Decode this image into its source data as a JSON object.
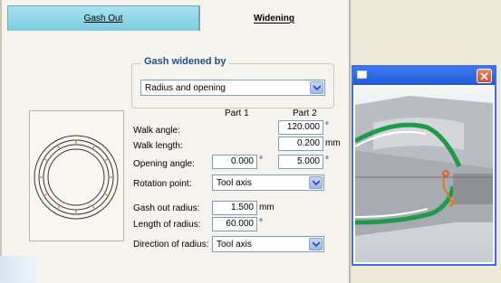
{
  "tabs": [
    {
      "label": "Gash Out",
      "active": false
    },
    {
      "label": "Widening",
      "active": true
    }
  ],
  "group": {
    "title": "Gash widened by",
    "method_value": "Radius and opening"
  },
  "columns": {
    "part1": "Part 1",
    "part2": "Part 2"
  },
  "params": {
    "walk_angle": {
      "label": "Walk angle:",
      "part2": "120.000",
      "unit": "°"
    },
    "walk_length": {
      "label": "Walk length:",
      "part2": "0.200",
      "unit": "mm"
    },
    "opening_angle": {
      "label": "Opening angle:",
      "part1": "0.000",
      "part1_unit": "°",
      "part2": "5.000",
      "part2_unit": "°"
    },
    "rotation_point": {
      "label": "Rotation point:",
      "value": "Tool axis"
    },
    "gash_out_radius": {
      "label": "Gash out radius:",
      "value": "1.500",
      "unit": "mm"
    },
    "length_of_radius": {
      "label": "Length of radius:",
      "value": "60.000",
      "unit": "°"
    },
    "direction_of_radius": {
      "label": "Direction of radius:",
      "value": "Tool axis"
    }
  },
  "colors": {
    "active_tab": "#7cccde",
    "group_title": "#21508c",
    "titlebar": "#2158d4",
    "close_button": "#cf4a22",
    "tool_green": "#1f9a4a",
    "arrow_orange": "#e07b1a"
  }
}
